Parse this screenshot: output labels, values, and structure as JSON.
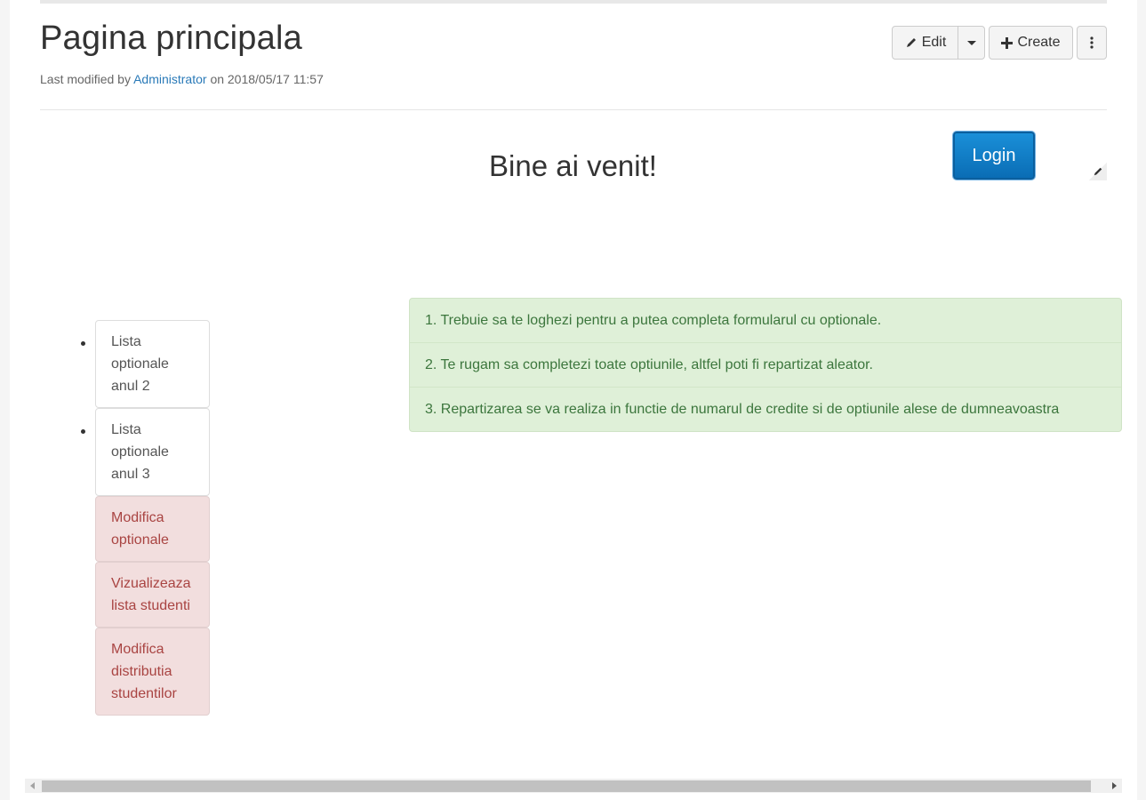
{
  "header": {
    "title": "Pagina principala",
    "meta_prefix": "Last modified by",
    "meta_user": "Administrator",
    "meta_suffix": "on 2018/05/17 11:57"
  },
  "toolbar": {
    "edit_label": "Edit",
    "create_label": "Create",
    "edit_icon": "pencil-icon",
    "create_icon": "plus-icon",
    "more_icon": "more-vertical-icon",
    "caret_icon": "caret-down-icon"
  },
  "content": {
    "welcome": "Bine ai venit!",
    "login_label": "Login",
    "login_color": "#0a6db5"
  },
  "menu": {
    "items": [
      {
        "label": "Lista optionale anul 2"
      },
      {
        "label": "Lista optionale anul 3"
      },
      {
        "label": "Modifica optionale"
      },
      {
        "label": "Vizualizeaza lista studenti"
      },
      {
        "label": "Modifica distributia studentilor"
      }
    ]
  },
  "info": {
    "items": [
      "1. Trebuie sa te loghezi pentru a putea completa formularul cu optionale.",
      "2. Te rugam sa completezi toate optiunile, altfel poti fi repartizat aleator.",
      "3. Repartizarea se va realiza in functie de numarul de credite si de optiunile alese de dumneavoastra"
    ],
    "color": "#dff0d8"
  }
}
